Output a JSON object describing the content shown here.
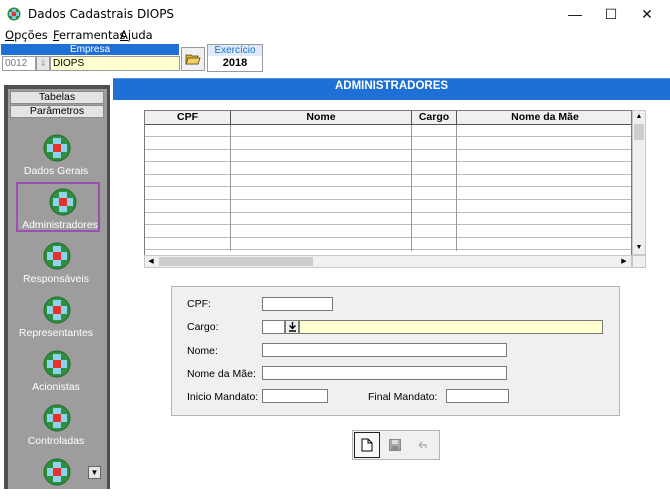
{
  "window": {
    "title": "Dados Cadastrais DIOPS",
    "controls": {
      "minimize": "—",
      "maximize": "☐",
      "close": "✕"
    }
  },
  "menu": {
    "items": [
      {
        "label_first": "O",
        "label_rest": "pções"
      },
      {
        "label_first": "F",
        "label_rest": "erramentas"
      },
      {
        "label_first": "A",
        "label_rest": "juda"
      }
    ]
  },
  "empresa": {
    "header": "Empresa",
    "code": "0012",
    "name": "DIOPS"
  },
  "exercicio": {
    "label": "Exercício",
    "year": "2018"
  },
  "section_title": "ADMINISTRADORES",
  "sidebar": {
    "tabs": [
      "Tabelas",
      "Parâmetros"
    ],
    "items": [
      "Dados Gerais",
      "Administradores",
      "Responsáveis",
      "Representantes",
      "Acionistas",
      "Controladas"
    ],
    "selected": "Administradores"
  },
  "grid": {
    "columns": [
      "CPF",
      "Nome",
      "Cargo",
      "Nome da Mãe"
    ],
    "rows": []
  },
  "form": {
    "cpf_label": "CPF:",
    "cargo_label": "Cargo:",
    "nome_label": "Nome:",
    "nome_mae_label": "Nome da Mãe:",
    "inicio_label": "Inicio Mandato:",
    "final_label": "Final Mandato:",
    "cpf_value": "",
    "cargo_code": "",
    "cargo_desc": "",
    "nome_value": "",
    "nome_mae_value": "",
    "inicio_value": "",
    "final_value": ""
  },
  "colors": {
    "accent": "#1e6fd6",
    "sidebar_bg": "#9d9d9d",
    "selected_border": "#9b4fb5",
    "yellow_field": "#ffffd0"
  }
}
